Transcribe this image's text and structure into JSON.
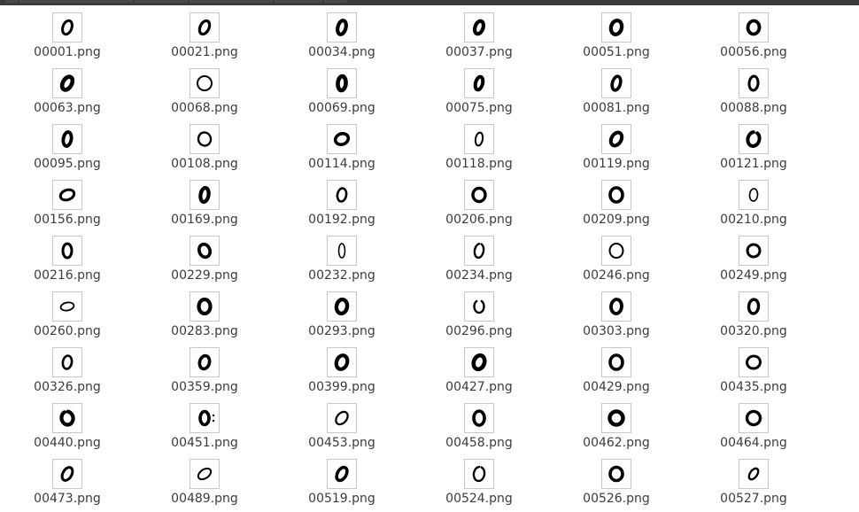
{
  "files": [
    "00001.png",
    "00021.png",
    "00034.png",
    "00037.png",
    "00051.png",
    "00056.png",
    "00063.png",
    "00068.png",
    "00069.png",
    "00075.png",
    "00081.png",
    "00088.png",
    "00095.png",
    "00108.png",
    "00114.png",
    "00118.png",
    "00119.png",
    "00121.png",
    "00156.png",
    "00169.png",
    "00192.png",
    "00206.png",
    "00209.png",
    "00210.png",
    "00216.png",
    "00229.png",
    "00232.png",
    "00234.png",
    "00246.png",
    "00249.png",
    "00260.png",
    "00283.png",
    "00293.png",
    "00296.png",
    "00303.png",
    "00320.png",
    "00326.png",
    "00359.png",
    "00399.png",
    "00427.png",
    "00429.png",
    "00435.png",
    "00440.png",
    "00451.png",
    "00453.png",
    "00458.png",
    "00462.png",
    "00464.png",
    "00473.png",
    "00489.png",
    "00519.png",
    "00524.png",
    "00526.png",
    "00527.png"
  ],
  "thumbnail_content": "handwritten-zero-digit-icon",
  "colors": {
    "title_bar": "#3c3b37",
    "label_text": "#3c3c3c",
    "thumbnail_border": "#c8c8c8",
    "ink": "#000000"
  }
}
